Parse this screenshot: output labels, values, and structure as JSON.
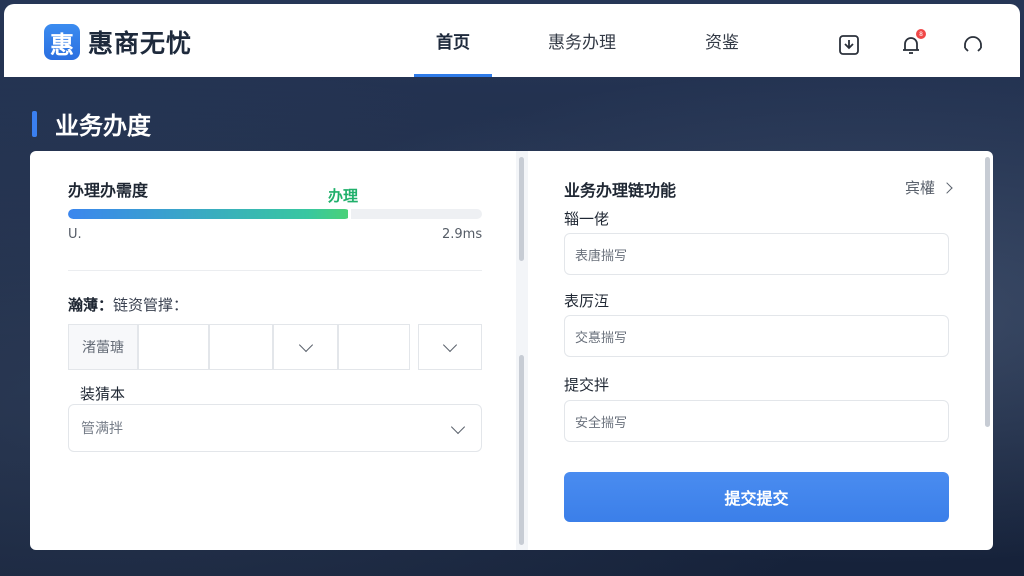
{
  "app": {
    "brand_logo_text": "惠",
    "brand_name": "惠商无忧"
  },
  "nav": {
    "tabs": [
      {
        "label": "首页",
        "active": true
      },
      {
        "label": "惠务办理",
        "active": false
      },
      {
        "label": "资鉴",
        "active": false
      }
    ],
    "icons": [
      "download-icon",
      "bell-icon",
      "headset-icon"
    ],
    "notification_count": "8"
  },
  "page": {
    "section_title": "业务办度"
  },
  "progress": {
    "title": "办理办需度",
    "current_label": "办理",
    "percent": 68,
    "min_label": "U.",
    "max_label": "2.9ms"
  },
  "filter": {
    "label_bold": "瀚薄：",
    "label_rest": "链资管撑：",
    "first_cell": "渚蕾瑭"
  },
  "left_form": {
    "field_label": "装猜本",
    "field_value": "管满拌"
  },
  "right_form": {
    "title": "业务办理链功能",
    "more_label": "宾權",
    "fields": [
      {
        "label": "辎一佬",
        "placeholder": "表唐揣写"
      },
      {
        "label": "表厉沍",
        "placeholder": "交惪揣写"
      },
      {
        "label": "提交拌",
        "placeholder": "安全揣写"
      }
    ],
    "submit_label": "提交提交"
  },
  "colors": {
    "accent": "#3b7fe9",
    "progress_end": "#4cd276",
    "flag_green": "#20b06b",
    "badge": "#f04848"
  }
}
